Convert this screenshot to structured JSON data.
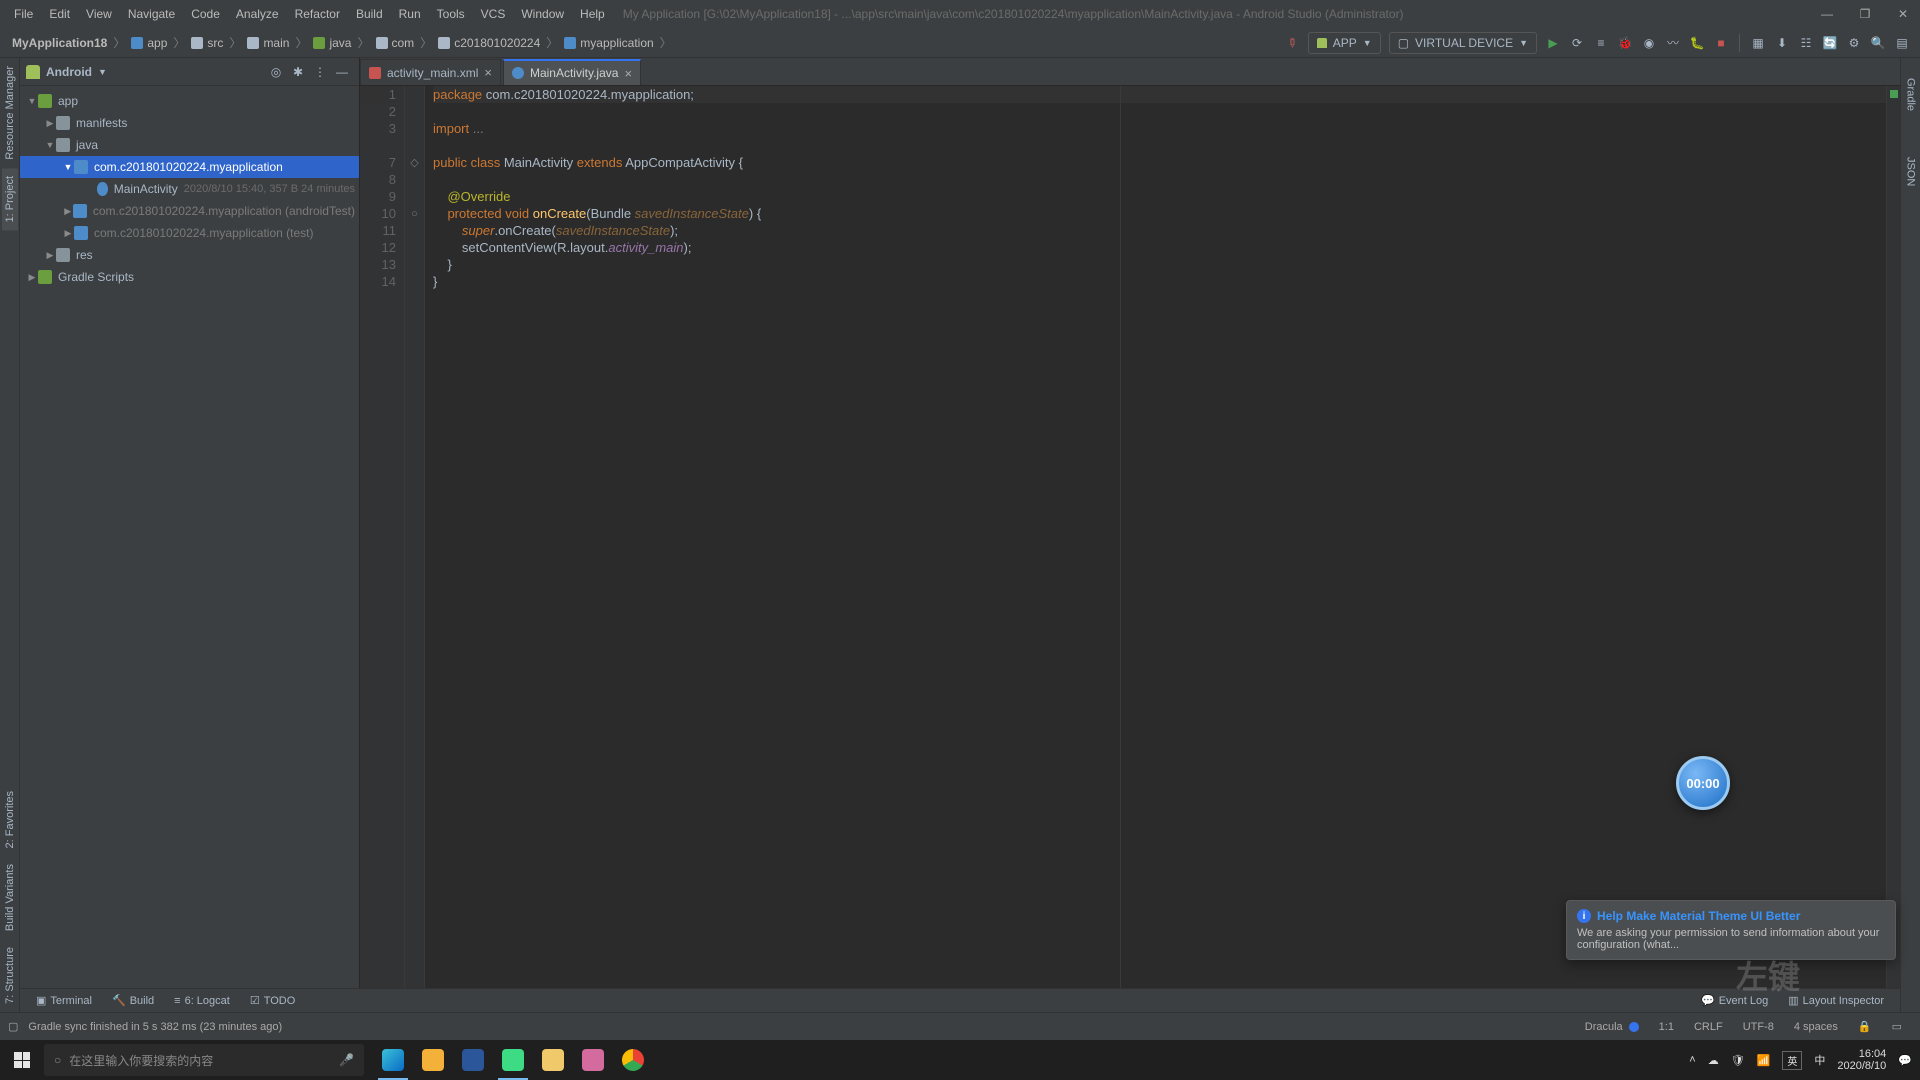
{
  "menu": {
    "file": "File",
    "edit": "Edit",
    "view": "View",
    "navigate": "Navigate",
    "code": "Code",
    "analyze": "Analyze",
    "refactor": "Refactor",
    "build": "Build",
    "run": "Run",
    "tools": "Tools",
    "vcs": "VCS",
    "window": "Window",
    "help": "Help"
  },
  "title_bar": "My Application [G:\\02\\MyApplication18] - ...\\app\\src\\main\\java\\com\\c201801020224\\myapplication\\MainActivity.java - Android Studio (Administrator)",
  "breadcrumb": {
    "root": "MyApplication18",
    "app": "app",
    "src": "src",
    "main": "main",
    "java": "java",
    "com": "com",
    "cid": "c201801020224",
    "pkg": "myapplication"
  },
  "run": {
    "config": "APP",
    "device": "VIRTUAL DEVICE"
  },
  "project": {
    "view": "Android",
    "app": "app",
    "manifests": "manifests",
    "java": "java",
    "pkg_main": "com.c201801020224.myapplication",
    "main_activity": "MainActivity",
    "main_activity_meta": "2020/8/10 15:40, 357 B  24 minutes",
    "pkg_android_test": "com.c201801020224.myapplication (androidTest)",
    "pkg_test": "com.c201801020224.myapplication (test)",
    "res": "res",
    "gradle": "Gradle Scripts"
  },
  "left_tabs": {
    "resource_manager": "Resource Manager",
    "project": "1: Project",
    "favorites": "2: Favorites",
    "build_variants": "Build Variants",
    "structure": "7: Structure"
  },
  "right_tabs": {
    "gradle": "Gradle",
    "json": "JSON"
  },
  "editor_tabs": {
    "layout": "activity_main.xml",
    "activity": "MainActivity.java"
  },
  "code": {
    "l1_kw": "package",
    "l1_rest": " com.c201801020224.myapplication;",
    "l3_kw": "import",
    "l3_rest": " ...",
    "l7": "public class MainActivity extends AppCompatActivity {",
    "l7_public": "public ",
    "l7_class": "class ",
    "l7_name": "MainActivity ",
    "l7_extends": "extends ",
    "l7_super": "AppCompatActivity ",
    "l7_brace": "{",
    "l9_ann": "@Override",
    "l10_protected": "protected ",
    "l10_void": "void ",
    "l10_on": "onCreate",
    "l10_p_open": "(",
    "l10_bundle": "Bundle ",
    "l10_param": "savedInstanceState",
    "l10_p_close": ") {",
    "l11_super": "super",
    "l11_dot": ".",
    "l11_on": "onCreate(",
    "l11_param": "savedInstanceState",
    "l11_close": ");",
    "l12_set": "setContentView(",
    "l12_r": "R.layout.",
    "l12_layout": "activity_main",
    "l12_close": ");",
    "l13": "}",
    "l14": "}"
  },
  "bottom_tools": {
    "terminal": "Terminal",
    "build": "Build",
    "logcat": "6: Logcat",
    "todo": "TODO",
    "event_log": "Event Log",
    "layout_inspector": "Layout Inspector"
  },
  "status": {
    "msg": "Gradle sync finished in 5 s 382 ms (23 minutes ago)",
    "theme": "Dracula",
    "pos": "1:1",
    "line_sep": "CRLF",
    "encoding": "UTF-8",
    "indent": "4 spaces"
  },
  "toast": {
    "title": "Help Make Material Theme UI Better",
    "body": "We are asking your permission to send information about your configuration (what..."
  },
  "timer": "00:00",
  "overlay_text": "左键",
  "taskbar": {
    "search_placeholder": "在这里输入你要搜索的内容",
    "ime_eng": "英",
    "ime_lang": "中",
    "ime_mode": "英",
    "time": "16:04",
    "date": "2020/8/10"
  }
}
